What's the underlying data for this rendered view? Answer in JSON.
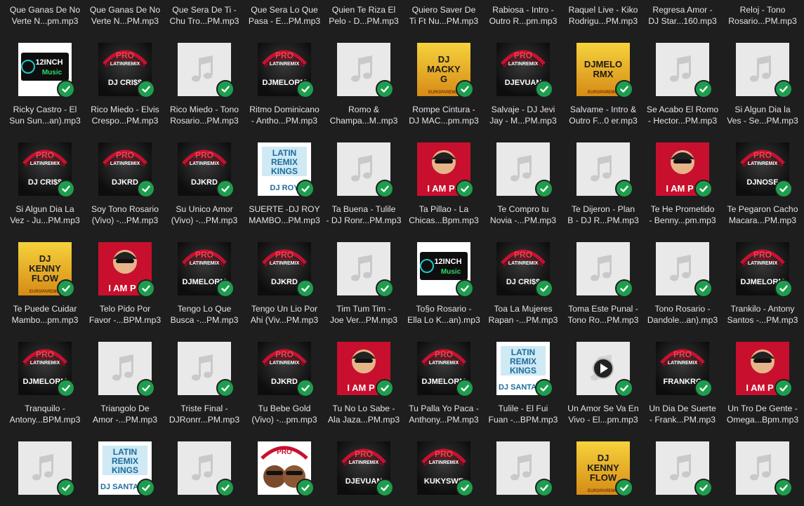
{
  "colors": {
    "background": "#1e1e1e",
    "check_badge": "#1f9d4e",
    "placeholder": "#e9e9e9",
    "pro_red": "#c8102e",
    "mix_gold": "#e8b322"
  },
  "rows": [
    {
      "labels": [
        [
          "Que Ganas De No",
          "Verte N...pm.mp3"
        ],
        [
          "Que Ganas De No",
          "Verte N...PM.mp3"
        ],
        [
          "Que Sera De Ti -",
          "Chu Tro...PM.mp3"
        ],
        [
          "Que Sera Lo Que",
          "Pasa - E...PM.mp3"
        ],
        [
          "Quien Te Riza El",
          "Pelo - D...PM.mp3"
        ],
        [
          "Quiero Saver De",
          "Ti Ft Nu...PM.mp3"
        ],
        [
          "Rabiosa - Intro -",
          "Outro R...pm.mp3"
        ],
        [
          "Raquel Live - Kiko",
          "Rodrigu...PM.mp3"
        ],
        [
          "Regresa Amor -",
          "DJ Star...160.mp3"
        ],
        [
          "Reloj - Tono",
          "Rosario...PM.mp3"
        ]
      ]
    },
    {
      "thumbs": [
        {
          "art": "inch12",
          "text": "12INCH"
        },
        {
          "art": "pro",
          "text": "DJ CRI$$"
        },
        {
          "art": "blank"
        },
        {
          "art": "pro",
          "text": "DJMELORM"
        },
        {
          "art": "blank"
        },
        {
          "art": "gold",
          "text": "DJ MACKY G"
        },
        {
          "art": "pro",
          "text": "DJEVUAN"
        },
        {
          "art": "gold",
          "text": "DJMELO RMX"
        },
        {
          "art": "blank"
        },
        {
          "art": "blank"
        }
      ],
      "labels": [
        [
          "Ricky Castro -  El",
          "Sun Sun...an).mp3"
        ],
        [
          "Rico Miedo - Elvis",
          "Crespo...PM.mp3"
        ],
        [
          "Rico Miedo - Tono",
          "Rosario...PM.mp3"
        ],
        [
          "Ritmo Dominicano",
          "- Antho...PM.mp3"
        ],
        [
          "Romo &",
          "Champa...M..mp3"
        ],
        [
          "Rompe Cintura -",
          "DJ MAC...pm.mp3"
        ],
        [
          "Salvaje - DJ Jevi",
          "Jay - M...PM.mp3"
        ],
        [
          "Salvame - Intro &",
          "Outro F...0 er.mp3"
        ],
        [
          "Se Acabo El Romo",
          "- Hector...PM.mp3"
        ],
        [
          "Si Algun Dia la",
          "Ves - Se...PM.mp3"
        ]
      ]
    },
    {
      "thumbs": [
        {
          "art": "pro",
          "text": "DJ CRI$$"
        },
        {
          "art": "pro",
          "text": "DJKRD"
        },
        {
          "art": "pro",
          "text": "DJKRD"
        },
        {
          "art": "latin",
          "text": "DJ ROY"
        },
        {
          "art": "blank"
        },
        {
          "art": "iamp",
          "text": "I AM P"
        },
        {
          "art": "blank"
        },
        {
          "art": "blank"
        },
        {
          "art": "iamp",
          "text": "I AM P"
        },
        {
          "art": "pro",
          "text": "DJNOSE"
        }
      ],
      "labels": [
        [
          "Si Algun Dia La",
          "Vez - Ju...PM.mp3"
        ],
        [
          "Soy Tono Rosario",
          "(Vivo) -...PM.mp3"
        ],
        [
          "Su Unico Amor",
          "(Vivo) -...PM.mp3"
        ],
        [
          "SUERTE -DJ ROY",
          "MAMBO...PM.mp3"
        ],
        [
          "Ta Buena - Tulile",
          "- DJ Ronr...PM.mp3"
        ],
        [
          "Ta Pillao - La",
          "Chicas...Bpm.mp3"
        ],
        [
          "Te Compro tu",
          "Novia -...PM.mp3"
        ],
        [
          "Te Dijeron - Plan",
          "B - DJ R...PM.mp3"
        ],
        [
          "Te He Prometido",
          "- Benny...pm.mp3"
        ],
        [
          "Te Pegaron Cacho",
          "Macara...PM.mp3"
        ]
      ]
    },
    {
      "thumbs": [
        {
          "art": "gold",
          "text": "DJ KENNY FLOW"
        },
        {
          "art": "iamp",
          "text": "I AM P"
        },
        {
          "art": "pro",
          "text": "DJMELORM"
        },
        {
          "art": "pro",
          "text": "DJKRD"
        },
        {
          "art": "blank"
        },
        {
          "art": "inch12",
          "text": "12INCH"
        },
        {
          "art": "pro",
          "text": "DJ CRI$$"
        },
        {
          "art": "blank"
        },
        {
          "art": "blank"
        },
        {
          "art": "pro",
          "text": "DJMELORM"
        }
      ],
      "labels": [
        [
          "Te Puede Cuidar",
          "Mambo...pm.mp3"
        ],
        [
          "Telo Pido Por",
          "Favor -...BPM.mp3"
        ],
        [
          "Tengo Lo Que",
          "Busca -...PM.mp3"
        ],
        [
          "Tengo Un Lio Por",
          "Ahi (Viv...PM.mp3"
        ],
        [
          "Tim Tum Tim -",
          "Joe Ver...PM.mp3"
        ],
        [
          "To§o Rosario -",
          "Ella Lo K...an).mp3"
        ],
        [
          "Toa La Mujeres",
          "Rapan -...PM.mp3"
        ],
        [
          "Toma Este Punal -",
          "Tono Ro...PM.mp3"
        ],
        [
          "Tono Rosario -",
          "Dandole...an).mp3"
        ],
        [
          "Trankilo - Antony",
          "Santos -...PM.mp3"
        ]
      ]
    },
    {
      "thumbs": [
        {
          "art": "pro",
          "text": "DJMELORM"
        },
        {
          "art": "blank"
        },
        {
          "art": "blank"
        },
        {
          "art": "pro",
          "text": "DJKRD"
        },
        {
          "art": "iamp",
          "text": "I AM P"
        },
        {
          "art": "pro",
          "text": "DJMELORM"
        },
        {
          "art": "latin",
          "text": "DJ SANTANA"
        },
        {
          "art": "video"
        },
        {
          "art": "pro",
          "text": "FRANKRO"
        },
        {
          "art": "iamp",
          "text": "I AM P"
        }
      ],
      "labels": [
        [
          "Tranquilo -",
          "Antony...BPM.mp3"
        ],
        [
          "Triangolo De",
          "Amor  -...PM.mp3"
        ],
        [
          "Triste Final -",
          "DJRonrr...PM.mp3"
        ],
        [
          "Tu Bebe Gold",
          "(Vivo) -...pm.mp3"
        ],
        [
          "Tu No Lo Sabe -",
          "Ala Jaza...PM.mp3"
        ],
        [
          "Tu Palla Yo Paca -",
          "Anthony...PM.mp3"
        ],
        [
          "Tulile - El Fui",
          "Fuan -...BPM.mp3"
        ],
        [
          "Un Amor Se Va En",
          "Vivo - El...pm.mp3"
        ],
        [
          "Un Dia De Suerte",
          "- Frank...PM.mp3"
        ],
        [
          "Un Tro De Gente -",
          "Omega...Bpm.mp3"
        ]
      ]
    },
    {
      "thumbs": [
        {
          "art": "blank"
        },
        {
          "art": "latin",
          "text": "DJ SANTANA"
        },
        {
          "art": "blank"
        },
        {
          "art": "faces",
          "text": "PRO"
        },
        {
          "art": "pro",
          "text": "DJEVUAN"
        },
        {
          "art": "pro",
          "text": "KUKYSWE"
        },
        {
          "art": "blank"
        },
        {
          "art": "gold",
          "text": "DJ KENNY FLOW"
        },
        {
          "art": "blank"
        },
        {
          "art": "blank"
        }
      ]
    }
  ]
}
